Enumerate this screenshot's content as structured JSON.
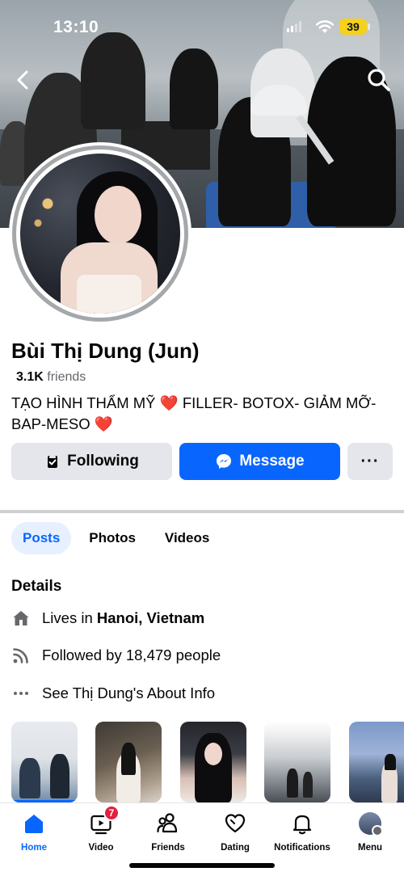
{
  "status_bar": {
    "time": "13:10",
    "battery": "39"
  },
  "profile": {
    "name": "Bùi Thị Dung (Jun)",
    "friends_count": "3.1K",
    "friends_label": "friends",
    "bio_line1": "TẠO HÌNH THẨM MỸ",
    "bio_line1_rest": "FILLER- BOTOX- GIẢM MỠ-",
    "bio_line2": "BAP-MESO",
    "heart": "❤️"
  },
  "actions": {
    "following_label": "Following",
    "message_label": "Message",
    "more_label": "···"
  },
  "tabs": [
    {
      "label": "Posts",
      "active": true
    },
    {
      "label": "Photos",
      "active": false
    },
    {
      "label": "Videos",
      "active": false
    }
  ],
  "details": {
    "title": "Details",
    "lives_prefix": "Lives in",
    "lives_place": "Hanoi, Vietnam",
    "followed_by": "Followed by 18,479 people",
    "about": "See Thị Dung's About Info"
  },
  "bottom_nav": [
    {
      "label": "Home",
      "icon": "home-icon",
      "active": true
    },
    {
      "label": "Video",
      "icon": "video-icon",
      "badge": "7"
    },
    {
      "label": "Friends",
      "icon": "friends-icon"
    },
    {
      "label": "Dating",
      "icon": "dating-heart-icon"
    },
    {
      "label": "Notifications",
      "icon": "bell-icon"
    },
    {
      "label": "Menu",
      "icon": "menu-avatar-icon"
    }
  ],
  "colors": {
    "accent": "#0866ff",
    "badge": "#e41e3f",
    "battery": "#f5d11c"
  }
}
